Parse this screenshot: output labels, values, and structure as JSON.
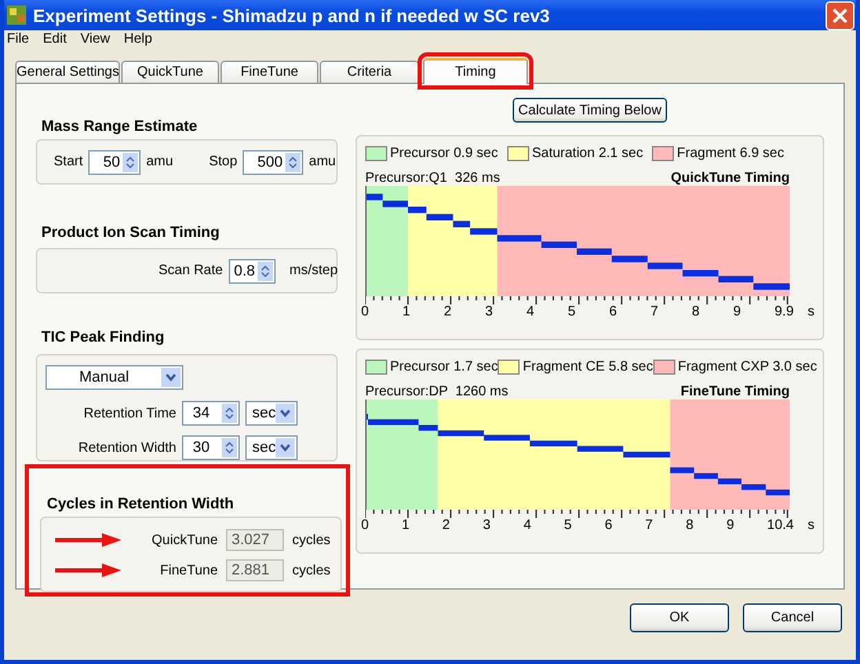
{
  "window": {
    "title": "Experiment Settings - Shimadzu p and n if needed w SC rev3"
  },
  "menu": [
    "File",
    "Edit",
    "View",
    "Help"
  ],
  "tabs": [
    {
      "label": "General Settings",
      "selected": false,
      "highlighted": false
    },
    {
      "label": "QuickTune",
      "selected": false,
      "highlighted": false
    },
    {
      "label": "FineTune",
      "selected": false,
      "highlighted": false
    },
    {
      "label": "Criteria",
      "selected": false,
      "highlighted": false
    },
    {
      "label": "Timing",
      "selected": true,
      "highlighted": true
    }
  ],
  "mass_range": {
    "title": "Mass Range Estimate",
    "fields": [
      {
        "label": "Start",
        "value": "50",
        "unit": "amu"
      },
      {
        "label": "Stop",
        "value": "500",
        "unit": "amu"
      }
    ]
  },
  "scan_timing": {
    "title": "Product Ion Scan Timing",
    "label": "Scan Rate",
    "value": "0.8",
    "unit": "ms/step"
  },
  "tic": {
    "title": "TIC Peak Finding",
    "mode": "Manual",
    "rows": [
      {
        "label": "Retention Time",
        "value": "34",
        "unit": "sec"
      },
      {
        "label": "Retention Width",
        "value": "30",
        "unit": "sec"
      }
    ]
  },
  "cycles": {
    "title": "Cycles in Retention Width",
    "highlighted": true,
    "rows": [
      {
        "label": "QuickTune",
        "value": "3.027",
        "unit": "cycles",
        "arrow": true
      },
      {
        "label": "FineTune",
        "value": "2.881",
        "unit": "cycles",
        "arrow": true
      }
    ]
  },
  "calculate_button": "Calculate Timing Below",
  "charts": [
    {
      "title": "QuickTune Timing",
      "subtitle": "Precursor:Q1  326 ms",
      "unit": "s",
      "ticks": [
        "0",
        "1",
        "2",
        "3",
        "4",
        "5",
        "6",
        "7",
        "8",
        "9",
        "9.9"
      ],
      "legend": [
        {
          "label": "Precursor 0.9 sec",
          "color": "#bbf7bb"
        },
        {
          "label": "Saturation 2.1 sec",
          "color": "#ffffa6"
        },
        {
          "label": "Fragment 6.9 sec",
          "color": "#ffb9b9"
        }
      ]
    },
    {
      "title": "FineTune Timing",
      "subtitle": "Precursor:DP  1260 ms",
      "unit": "s",
      "ticks": [
        "0",
        "1",
        "2",
        "3",
        "4",
        "5",
        "6",
        "7",
        "8",
        "9",
        "10.4"
      ],
      "legend": [
        {
          "label": "Precursor 1.7 sec",
          "color": "#bbf7bb"
        },
        {
          "label": "Fragment CE 5.8 sec",
          "color": "#ffffa6"
        },
        {
          "label": "Fragment CXP 3.0 sec",
          "color": "#ffb9b9"
        }
      ]
    }
  ],
  "buttons": [
    "OK",
    "Cancel"
  ]
}
